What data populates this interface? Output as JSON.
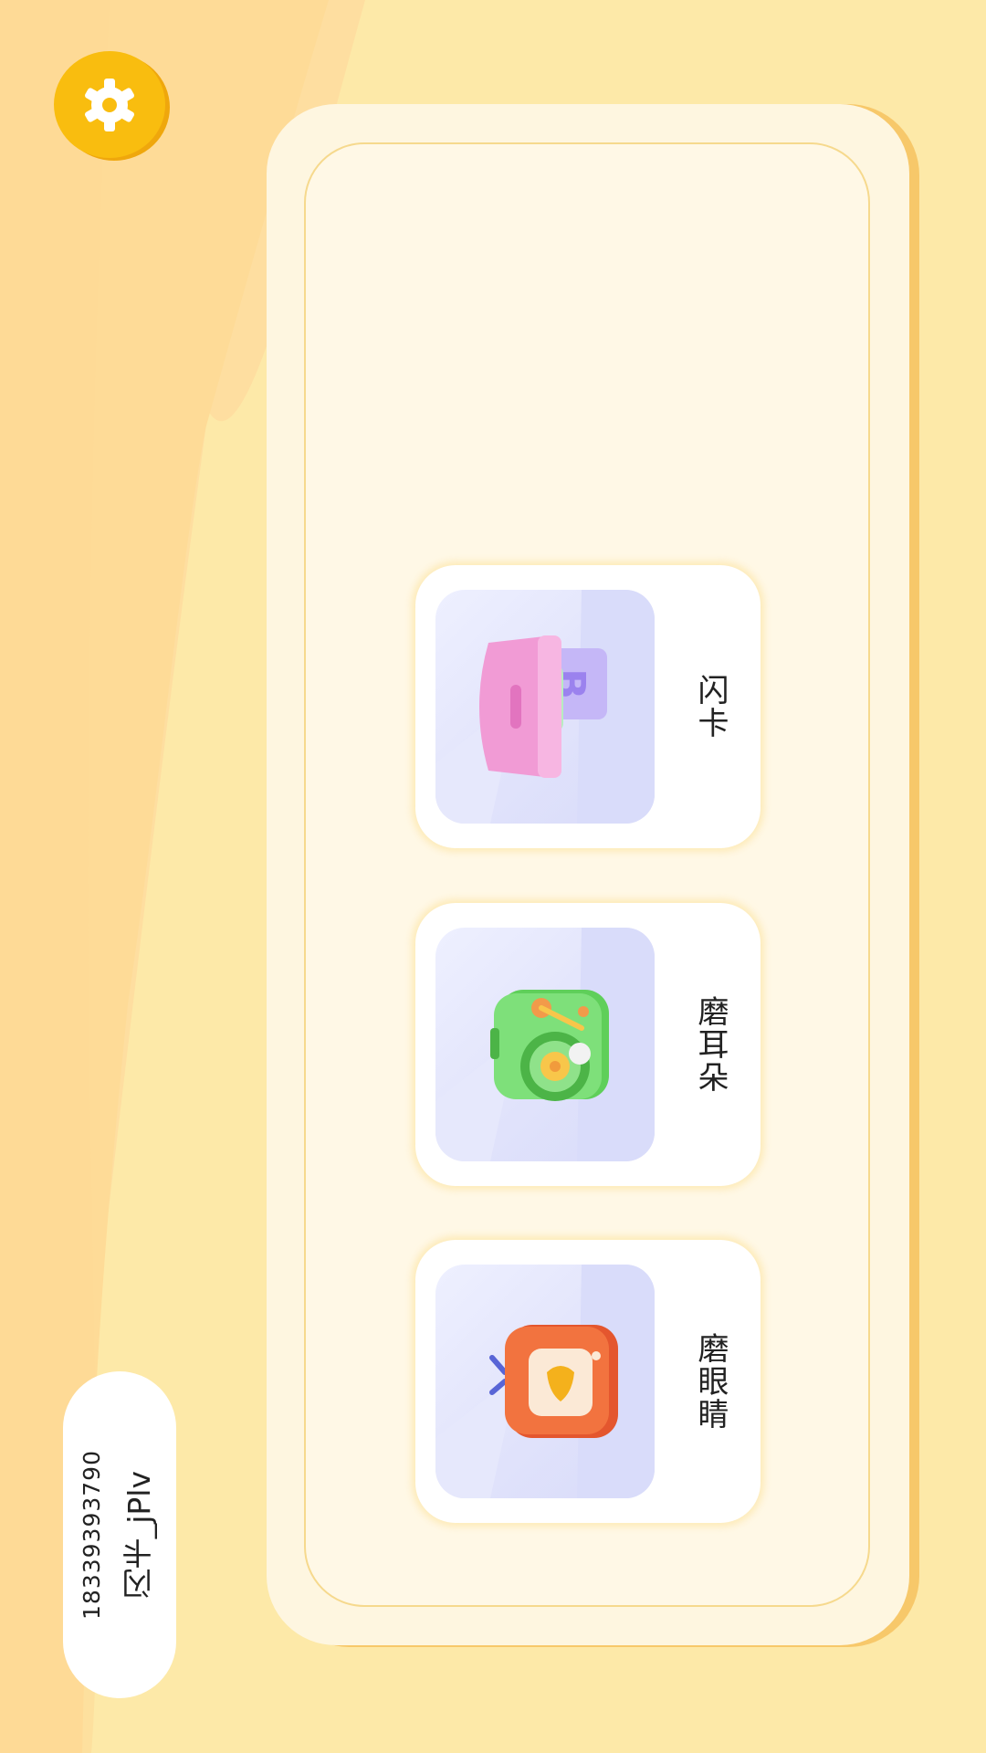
{
  "settings": {
    "icon": "gear-icon",
    "accent": "#f9bd0f"
  },
  "cards": [
    {
      "label": "闪卡",
      "icon": "abc-blocks-icon"
    },
    {
      "label": "磨耳朵",
      "icon": "radio-player-icon"
    },
    {
      "label": "磨眼睛",
      "icon": "retro-tv-icon"
    }
  ],
  "user": {
    "name": "闪卡_jPlv",
    "phone": "18339393790"
  },
  "colors": {
    "background": "#fde9a8",
    "panel": "#fef6e0",
    "card": "#ffffff",
    "thumb": "#e1e3fb"
  }
}
